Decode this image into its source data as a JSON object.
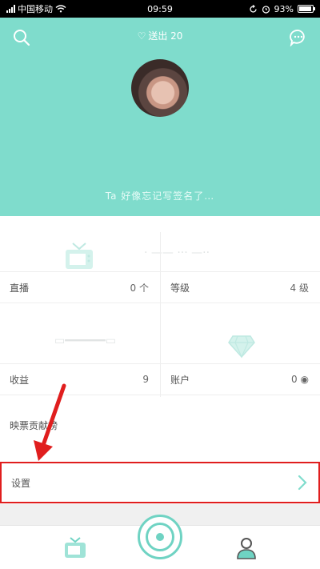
{
  "status_bar": {
    "carrier": "中国移动",
    "time": "09:59",
    "battery": "93%",
    "battery_level": 0.93
  },
  "header": {
    "fans_label": "送出 20",
    "signature": "Ta 好像忘记写签名了…",
    "bg_color": "#7fdccc"
  },
  "stats": {
    "guard": {
      "label": "直播",
      "value": "0 个"
    },
    "level": {
      "label": "等级",
      "value": "4 级"
    },
    "earnings": {
      "label": "收益",
      "value": "9"
    },
    "account": {
      "label": "账户",
      "value": "0"
    }
  },
  "list": {
    "ranking": {
      "label": "映票贡献榜"
    },
    "settings": {
      "label": "设置"
    }
  },
  "colors": {
    "accent": "#6fd3c3",
    "highlight": "#e01e1e"
  },
  "icons": {
    "search": "search-icon",
    "chat": "chat-icon",
    "tv": "tv-icon",
    "diamond": "diamond-icon",
    "camera": "camera-icon",
    "profile": "profile-icon"
  }
}
